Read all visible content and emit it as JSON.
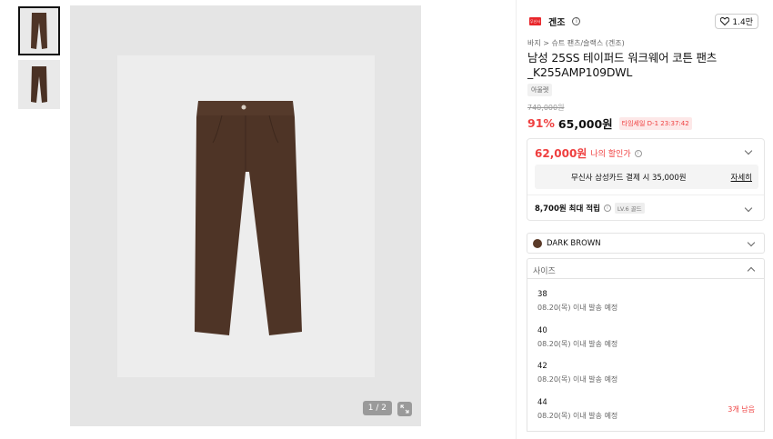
{
  "gallery": {
    "pager": "1 / 2",
    "thumbnails": [
      "pants-front",
      "pants-back"
    ]
  },
  "brand": {
    "logo_text": "무신사",
    "name": "겐조",
    "likes": "1.4만"
  },
  "product": {
    "breadcrumb": "바지 > 슈트 팬츠/슬랙스 (겐조)",
    "title": "남성 25SS 테이퍼드 워크웨어 코튼 팬츠_K255AMP109DWL",
    "tag": "아울렛",
    "original_price": "740,000원",
    "discount_rate": "91%",
    "price": "65,000원",
    "timer": "타임세일 D-1 23:37:42"
  },
  "my_discount": {
    "price": "62,000원",
    "label": "나의 할인가",
    "card_text": "무신사 삼성카드 결제 시 35,000원",
    "card_link": "자세히",
    "points": "8,700원 최대 적립",
    "level": "LV.6 골드"
  },
  "options": {
    "color": "DARK BROWN",
    "size_placeholder": "사이즈",
    "sizes": [
      {
        "size": "38",
        "ship": "08.20(목) 이내 발송 예정",
        "stock": ""
      },
      {
        "size": "40",
        "ship": "08.20(목) 이내 발송 예정",
        "stock": ""
      },
      {
        "size": "42",
        "ship": "08.20(목) 이내 발송 예정",
        "stock": ""
      },
      {
        "size": "44",
        "ship": "08.20(목) 이내 발송 예정",
        "stock": "3개 남음"
      }
    ]
  },
  "colors": {
    "accent_red": "#ef3f3f",
    "swatch": "#5a3a28"
  }
}
